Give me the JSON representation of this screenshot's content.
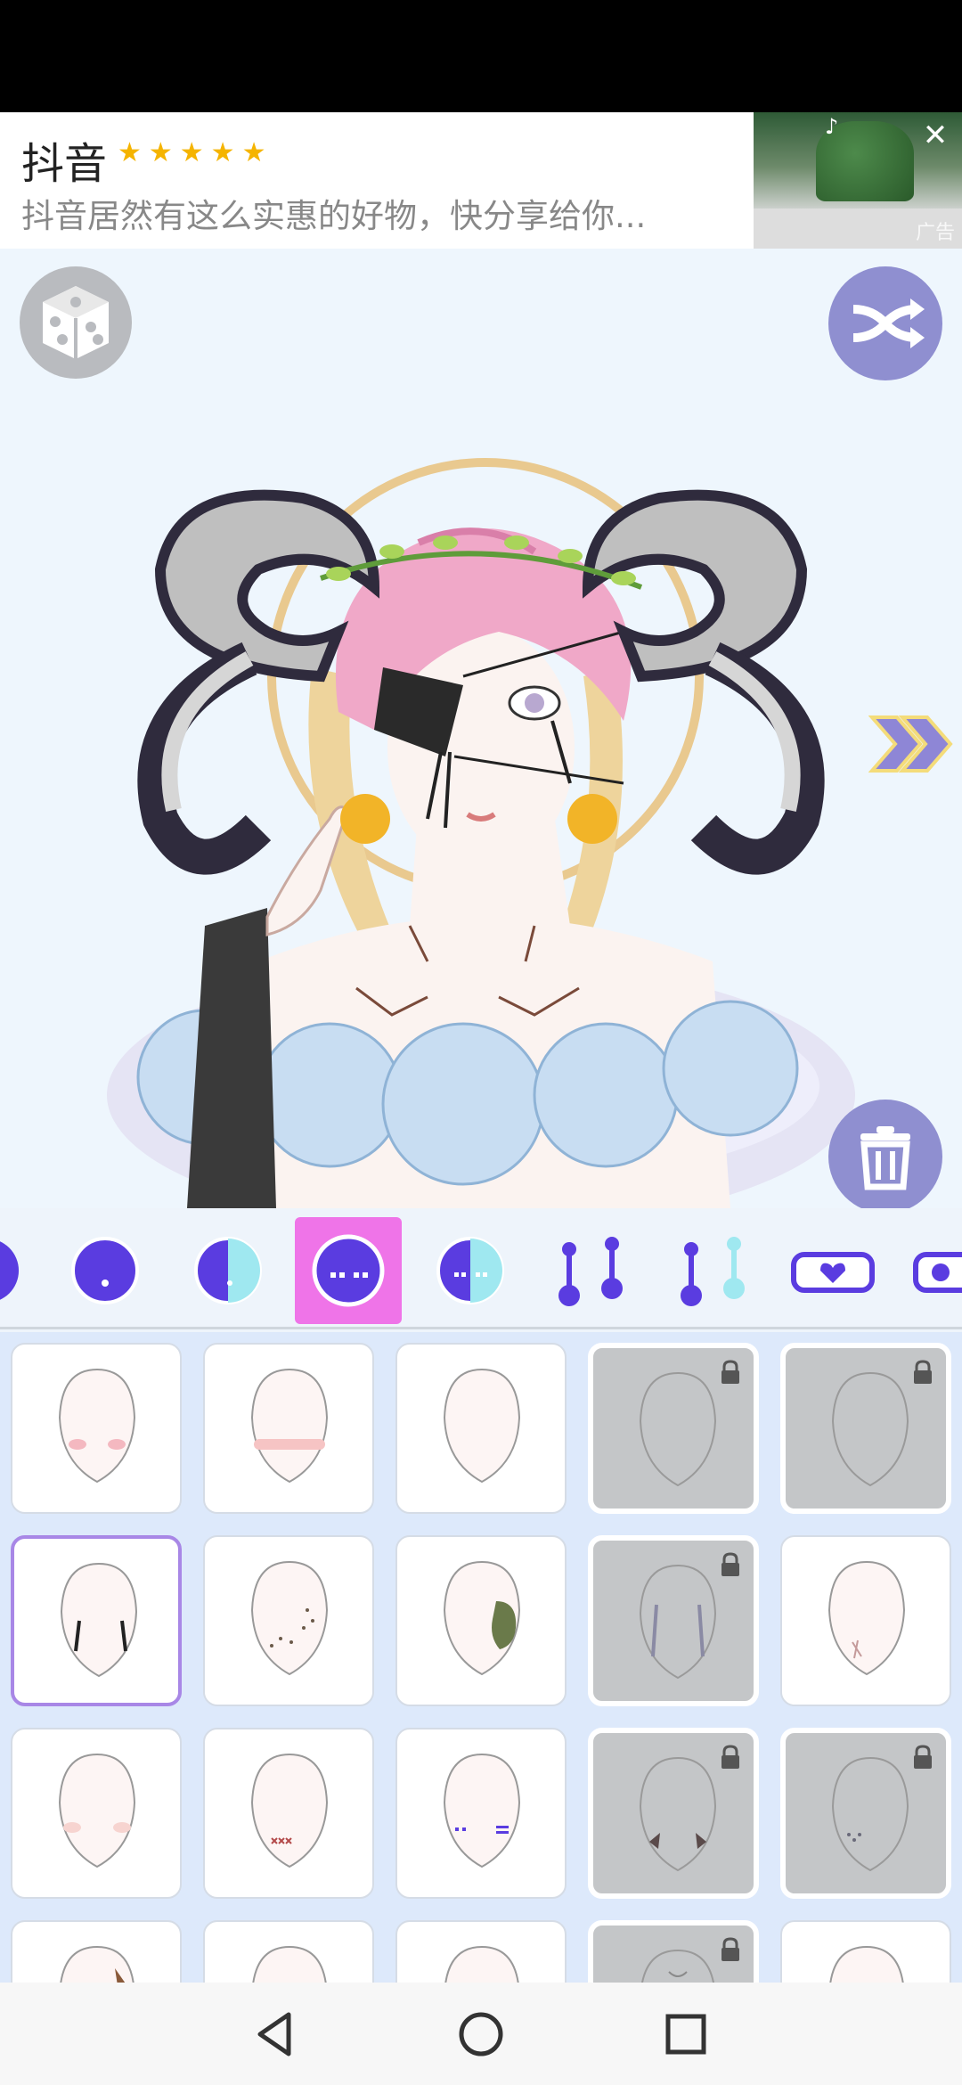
{
  "ad": {
    "title": "抖音",
    "stars": "★★★★★",
    "description": "抖音居然有这么实惠的好物，快分享给你...",
    "close_icon": "close-icon",
    "label": "广告"
  },
  "stage": {
    "randomize_icon": "dice-icon",
    "shuffle_icon": "shuffle-icon",
    "next_icon": "double-chevron-right-icon",
    "delete_icon": "trash-icon",
    "accent_color": "#8f8fd0"
  },
  "category_tabs": [
    {
      "name": "face-half-tab"
    },
    {
      "name": "face-mouth-tab"
    },
    {
      "name": "face-split-tab"
    },
    {
      "name": "face-marks-tab",
      "selected": true
    },
    {
      "name": "face-split-marks-tab"
    },
    {
      "name": "piercing-tab"
    },
    {
      "name": "piercing-cyan-tab"
    },
    {
      "name": "heart-eyepatch-tab"
    },
    {
      "name": "eyepatch-tab"
    }
  ],
  "tab_selected_color": "#ef74e8",
  "items": [
    {
      "name": "face-heart-blush",
      "locked": false
    },
    {
      "name": "face-blush",
      "locked": false
    },
    {
      "name": "face-faint",
      "locked": false
    },
    {
      "name": "face-locked-1",
      "locked": true
    },
    {
      "name": "face-locked-2",
      "locked": true
    },
    {
      "name": "face-tear-lines",
      "locked": false,
      "selected": true
    },
    {
      "name": "face-freckles",
      "locked": false
    },
    {
      "name": "face-green-patch",
      "locked": false
    },
    {
      "name": "face-locked-3",
      "locked": true
    },
    {
      "name": "face-cross-scar",
      "locked": false
    },
    {
      "name": "face-cheek-blush",
      "locked": false
    },
    {
      "name": "face-xxx-mark",
      "locked": false
    },
    {
      "name": "face-bars",
      "locked": false
    },
    {
      "name": "face-locked-4",
      "locked": true
    },
    {
      "name": "face-locked-5",
      "locked": true
    },
    {
      "name": "face-partial-1",
      "locked": false
    },
    {
      "name": "face-partial-2",
      "locked": false
    },
    {
      "name": "face-partial-3",
      "locked": false
    },
    {
      "name": "face-locked-6",
      "locked": true
    },
    {
      "name": "face-partial-5",
      "locked": false
    }
  ],
  "navbar": {
    "back_icon": "back-icon",
    "home_icon": "home-icon",
    "recents_icon": "recents-icon"
  }
}
